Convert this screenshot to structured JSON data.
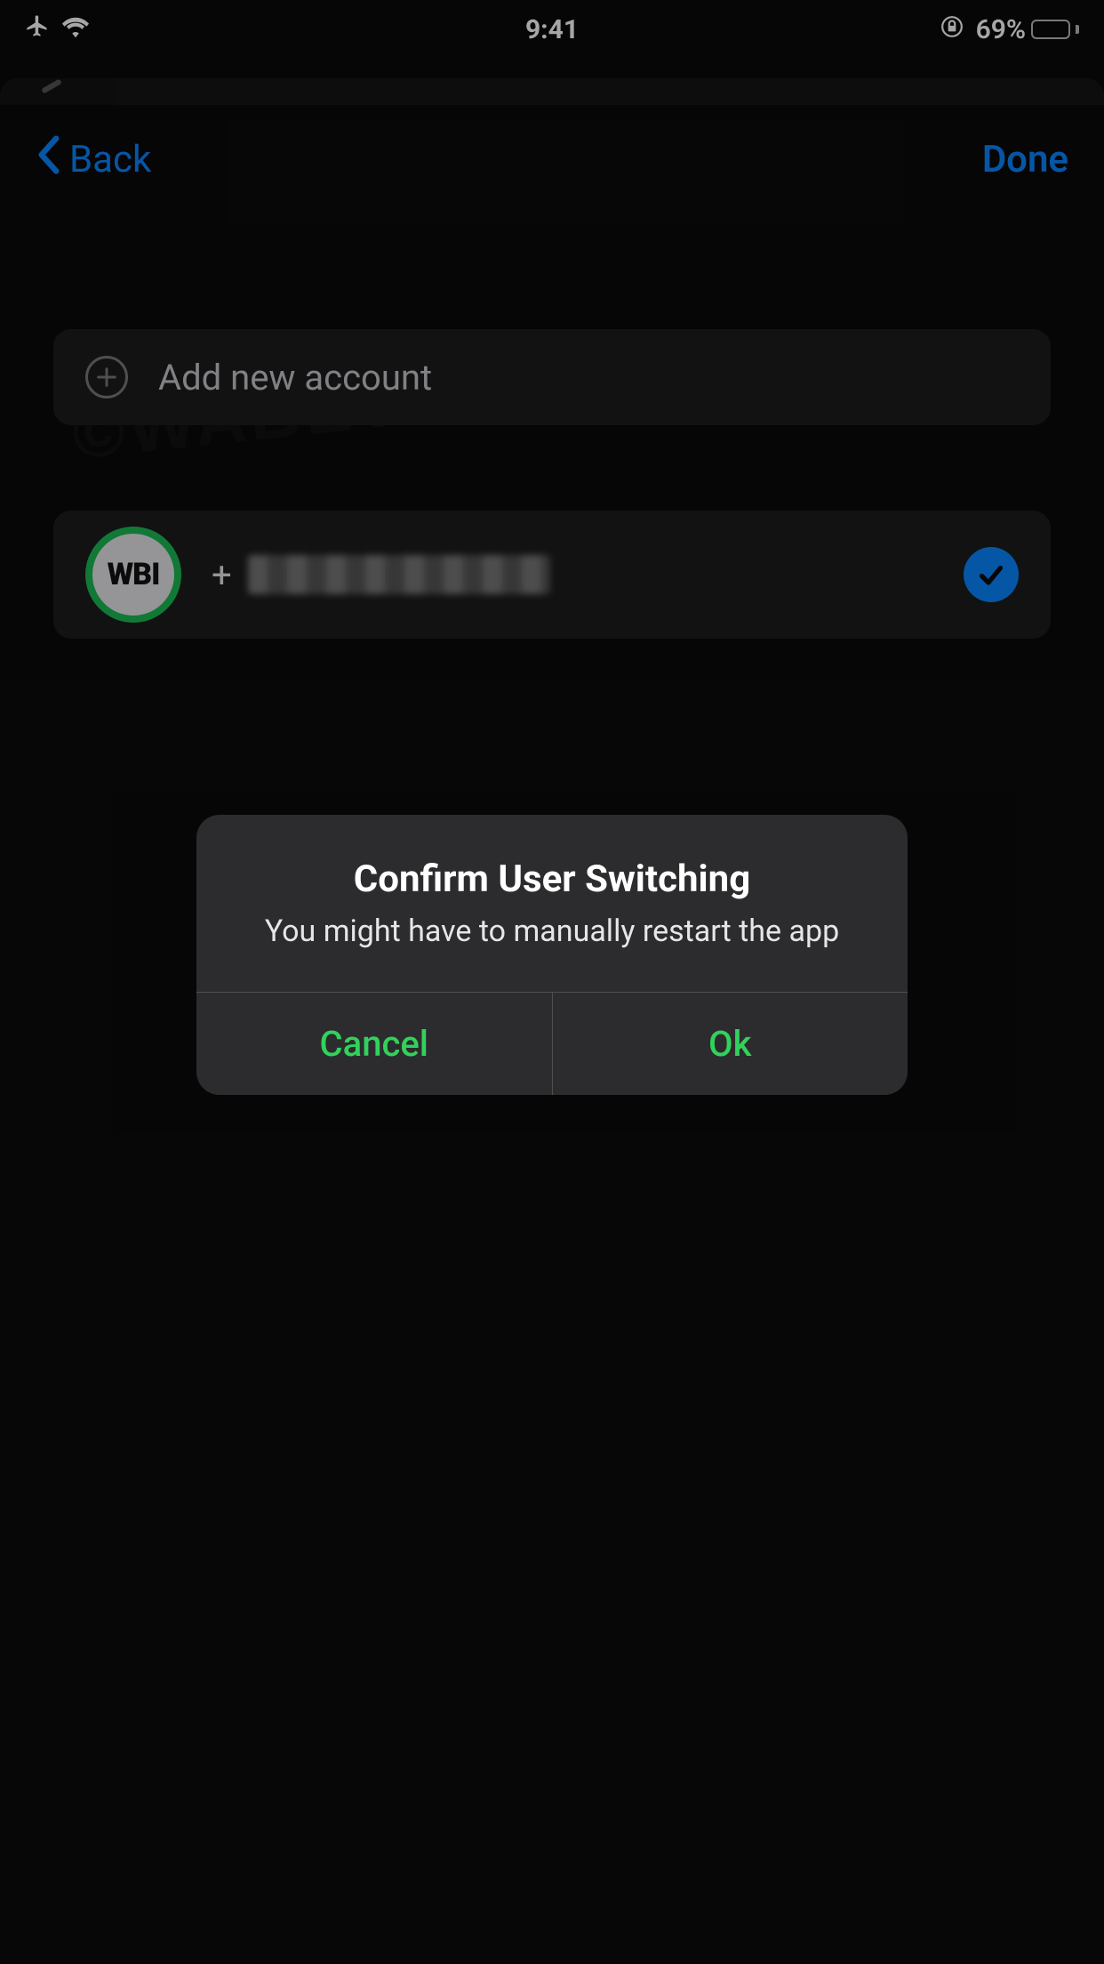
{
  "status_bar": {
    "time": "9:41",
    "battery_pct": "69%"
  },
  "nav": {
    "back_label": "Back",
    "done_label": "Done"
  },
  "add_account": {
    "label": "Add new account"
  },
  "account": {
    "avatar_text": "WBI",
    "number_prefix": "+",
    "number_redacted": true,
    "selected": true
  },
  "alert": {
    "title": "Confirm User Switching",
    "message": "You might have to manually restart the app",
    "cancel_label": "Cancel",
    "ok_label": "Ok"
  },
  "watermark": "©WABETAINFO",
  "colors": {
    "accent_blue": "#0a84ff",
    "accent_green": "#32d15b",
    "avatar_ring": "#1db954",
    "battery_fill": "#ffd60a"
  }
}
